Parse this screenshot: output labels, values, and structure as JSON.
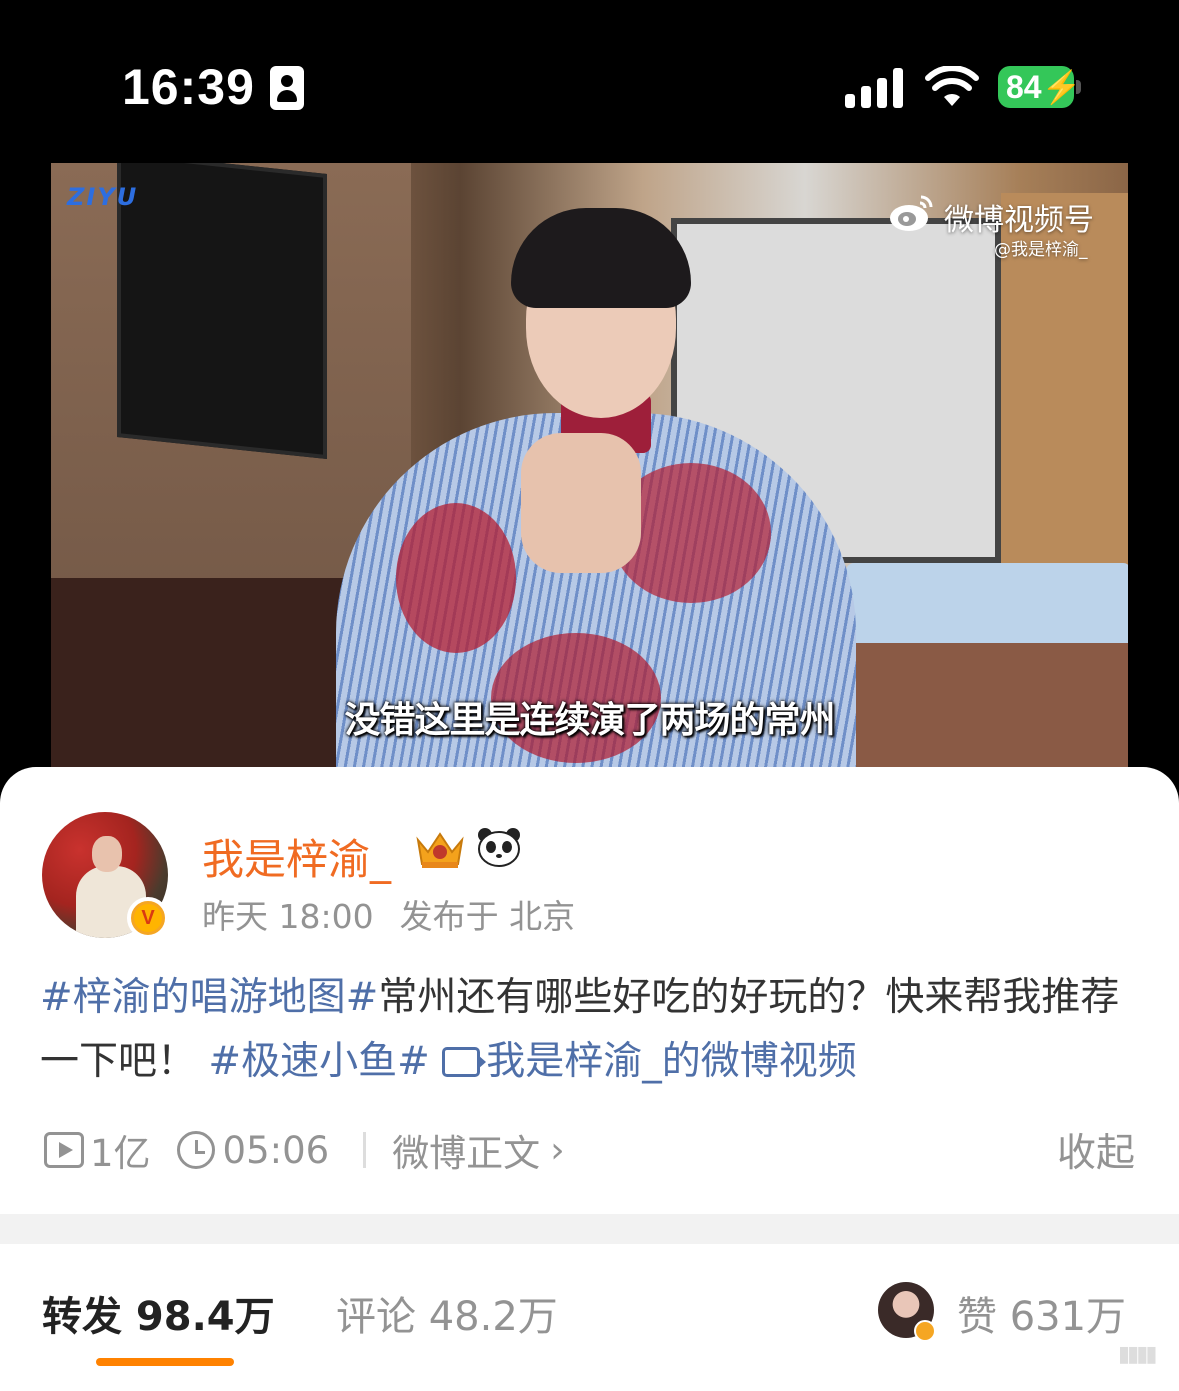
{
  "status_bar": {
    "time": "16:39",
    "battery": "84"
  },
  "video": {
    "logo_left": "ZIYU",
    "brand": "微博视频号",
    "brand_handle": "@我是梓渝_",
    "subtitle": "没错这里是连续演了两场的常州"
  },
  "post": {
    "username": "我是梓渝_",
    "time": "昨天 18:00",
    "location": "发布于 北京",
    "text": {
      "tag1": "#梓渝的唱游地图#",
      "body": "常州还有哪些好吃的好玩的？快来帮我推荐一下吧！",
      "tag2": "#极速小鱼#",
      "video_link": "我是梓渝_的微博视频"
    },
    "views": "1亿",
    "duration": "05:06",
    "full_text_link": "微博正文",
    "collapse": "收起"
  },
  "tabs": {
    "repost": "转发 98.4万",
    "comment": "评论 48.2万",
    "like": "赞 631万"
  },
  "colors": {
    "username": "#f06b22",
    "link": "#4f6fa8",
    "accent": "#ff8200",
    "battery": "#34c759"
  }
}
